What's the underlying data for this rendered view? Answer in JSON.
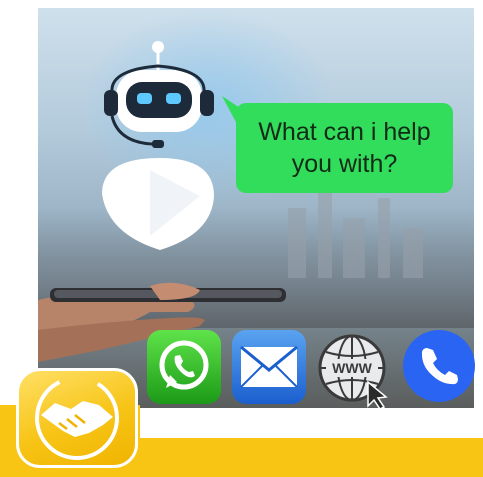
{
  "bubble": {
    "text": "What can i help you with?"
  },
  "apps": [
    {
      "name": "WhatsApp"
    },
    {
      "name": "Mail"
    },
    {
      "name": "Web",
      "label": "WWW"
    },
    {
      "name": "Phone"
    }
  ],
  "colors": {
    "bubble": "#33dd5c",
    "accent_yellow": "#f9c514",
    "whatsapp": "#25c11e",
    "mail": "#2f7fe0",
    "phone": "#2a64f2"
  },
  "icons": [
    "robot-icon",
    "whatsapp-icon",
    "mail-icon",
    "www-globe-icon",
    "phone-icon",
    "handshake-icon"
  ]
}
